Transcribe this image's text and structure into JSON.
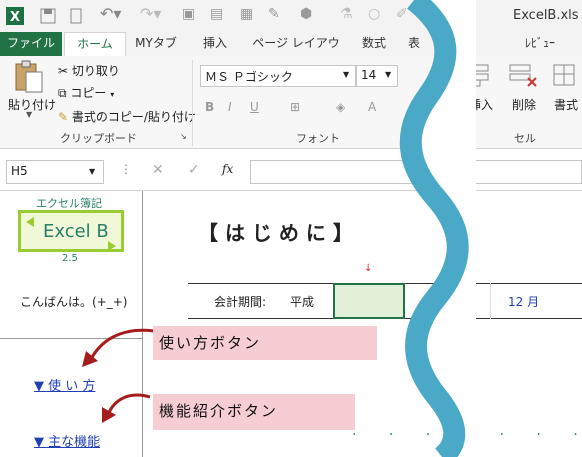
{
  "window": {
    "title": "ExcelB.xls"
  },
  "tabs": [
    "ファイル",
    "ホーム",
    "MYタブ",
    "挿入",
    "ページ レイアウト",
    "数式",
    "表",
    "ﾚﾋﾞｭｰ"
  ],
  "ribbon": {
    "paste_label": "貼り付け",
    "cut_label": "切り取り",
    "copy_label": "コピー",
    "format_painter_label": "書式のコピー/貼り付け",
    "clipboard_group": "クリップボード",
    "font_name": "ＭＳ Ｐゴシック",
    "font_size": "14",
    "font_group": "フォント",
    "insert_label": "挿入",
    "delete_label": "削除",
    "format_label": "書式",
    "cells_group": "セル"
  },
  "formula_bar": {
    "name_box": "H5",
    "fx": "fx",
    "formula": ""
  },
  "sheet": {
    "logo_caption": "エクセル簿記",
    "logo_text": "Excel B",
    "version": "2.5",
    "greeting": "こんばんは。(+_+)",
    "heading": "【 は じ め に 】",
    "period_label": "会計期間:",
    "era_label": "平成",
    "month_label": "12 月",
    "link_usage": "▼ 使 い 方",
    "link_features": "▼ 主な機能",
    "callout_usage": "使い方ボタン",
    "callout_features": "機能紹介ボタン",
    "dots": ". . . . . . ."
  },
  "colors": {
    "wave": "#4aa9c6",
    "callout_bg": "#f6cdd3",
    "link": "#1f3fb5",
    "arrow": "#a51c1c",
    "logo_border": "#99cc33",
    "logo_text": "#2a7f6b"
  }
}
